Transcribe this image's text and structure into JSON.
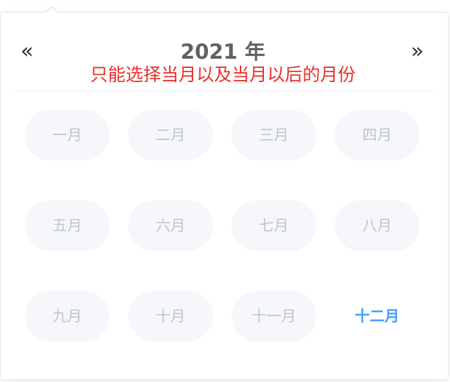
{
  "header": {
    "prev_icon": "double-chevron-left-icon",
    "prev_glyph": "«",
    "next_icon": "double-chevron-right-icon",
    "next_glyph": "»",
    "year": "2021 年",
    "tip": "只能选择当月以及当月以后的月份"
  },
  "months": [
    {
      "label": "一月",
      "state": "disabled"
    },
    {
      "label": "二月",
      "state": "disabled"
    },
    {
      "label": "三月",
      "state": "disabled"
    },
    {
      "label": "四月",
      "state": "disabled"
    },
    {
      "label": "五月",
      "state": "disabled"
    },
    {
      "label": "六月",
      "state": "disabled"
    },
    {
      "label": "七月",
      "state": "disabled"
    },
    {
      "label": "八月",
      "state": "disabled"
    },
    {
      "label": "九月",
      "state": "disabled"
    },
    {
      "label": "十月",
      "state": "disabled"
    },
    {
      "label": "十一月",
      "state": "disabled"
    },
    {
      "label": "十二月",
      "state": "current"
    }
  ],
  "colors": {
    "tip": "#e8312a",
    "current_month": "#409eff",
    "disabled_text": "#c0c4cc",
    "disabled_bg": "#f5f7fa"
  }
}
